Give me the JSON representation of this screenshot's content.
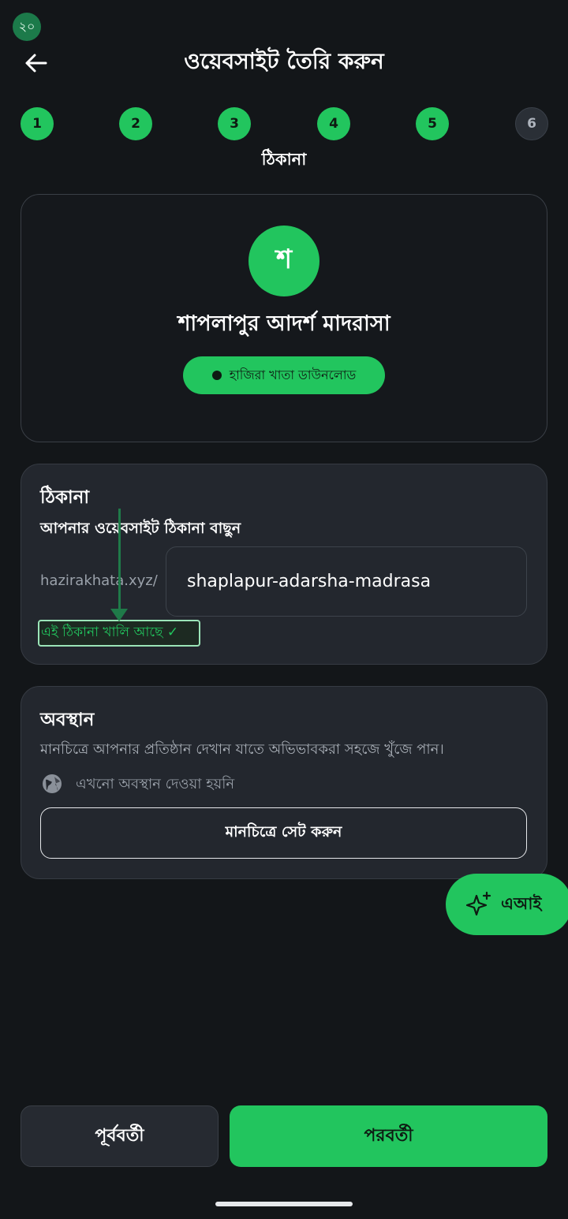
{
  "status_badge": "২০",
  "header": {
    "title": "ওয়েবসাইট তৈরি করুন"
  },
  "steps": [
    {
      "label": "1",
      "state": "done"
    },
    {
      "label": "2",
      "state": "done"
    },
    {
      "label": "3",
      "state": "done"
    },
    {
      "label": "4",
      "state": "done"
    },
    {
      "label": "5",
      "state": "done"
    },
    {
      "label": "6",
      "state": "pending"
    }
  ],
  "current_step_label": "ঠিকানা",
  "preview": {
    "avatar_letter": "শ",
    "school_name": "শাপলাপুর আদর্শ মাদরাসা",
    "pill_label": "হাজিরা খাতা ডাউনলোড"
  },
  "address": {
    "title": "ঠিকানা",
    "subtitle": "আপনার ওয়েবসাইট ঠিকানা বাছুন",
    "prefix": "hazirakhata.xyz/",
    "value": "shaplapur-adarsha-madrasa",
    "availability": "এই ঠিকানা খালি আছে ✓"
  },
  "location": {
    "title": "অবস্থান",
    "description": "মানচিত্রে আপনার প্রতিষ্ঠান দেখান যাতে অভিভাবকরা সহজে খুঁজে পান।",
    "status": "এখনো অবস্থান দেওয়া হয়নি",
    "button": "মানচিত্রে সেট করুন"
  },
  "ai_button": "এআই",
  "footer": {
    "prev": "পূর্ববর্তী",
    "next": "পরবর্তী"
  },
  "colors": {
    "accent": "#22c55e",
    "background": "#131619",
    "card": "#23272e"
  }
}
